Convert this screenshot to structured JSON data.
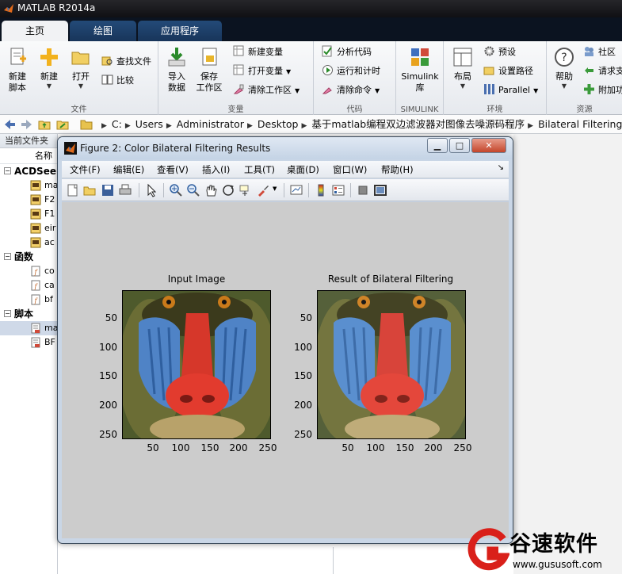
{
  "app": {
    "title": "MATLAB R2014a"
  },
  "ribbon_tabs": [
    {
      "label": "主页",
      "active": true
    },
    {
      "label": "绘图",
      "active": false
    },
    {
      "label": "应用程序",
      "active": false
    }
  ],
  "ribbon": {
    "file": {
      "new_script": "新建\n脚本",
      "new": "新建",
      "open": "打开",
      "find_files": "查找文件",
      "compare": "比较",
      "group": "文件"
    },
    "variable": {
      "import_data": "导入\n数据",
      "save_workspace": "保存\n工作区",
      "new_variable": "新建变量",
      "open_variable": "打开变量",
      "clear_workspace": "清除工作区",
      "group": "变量"
    },
    "code": {
      "analyze": "分析代码",
      "run_time": "运行和计时",
      "clear_commands": "清除命令",
      "group": "代码"
    },
    "simulink": {
      "library": "Simulink\n库",
      "group": "SIMULINK"
    },
    "environment": {
      "layout": "布局",
      "preferences": "预设",
      "set_path": "设置路径",
      "parallel": "Parallel",
      "group": "环境"
    },
    "resources": {
      "help": "帮助",
      "community": "社区",
      "request_support": "请求支",
      "addons": "附加功",
      "group": "资源"
    }
  },
  "address": {
    "path": [
      "C:",
      "Users",
      "Administrator",
      "Desktop",
      "基于matlab编程双边滤波器对图像去噪源码程序",
      "Bilateral Filtering"
    ]
  },
  "left_panel": {
    "header": "当前文件夹",
    "column": "名称",
    "sections": [
      {
        "label": "ACDSee",
        "files": [
          "ma",
          "F2",
          "F1",
          "eir",
          "ac"
        ]
      },
      {
        "label": "函数",
        "files": [
          "co",
          "ca",
          "bf"
        ]
      },
      {
        "label": "脚本",
        "files": [
          "ma",
          "BF"
        ]
      }
    ]
  },
  "figure": {
    "title": "Figure 2: Color Bilateral Filtering Results",
    "menus": [
      "文件(F)",
      "编辑(E)",
      "查看(V)",
      "插入(I)",
      "工具(T)",
      "桌面(D)",
      "窗口(W)",
      "帮助(H)"
    ],
    "axes": [
      {
        "title": "Input Image",
        "yticks": [
          "50",
          "100",
          "150",
          "200",
          "250"
        ],
        "xticks": [
          "50",
          "100",
          "150",
          "200",
          "250"
        ]
      },
      {
        "title": "Result of Bilateral Filtering",
        "yticks": [
          "50",
          "100",
          "150",
          "200",
          "250"
        ],
        "xticks": [
          "50",
          "100",
          "150",
          "200",
          "250"
        ]
      }
    ]
  },
  "watermark": {
    "brand": "谷速软件",
    "url": "www.gususoft.com"
  },
  "colors": {
    "ribbon_active": "#f1f2f4",
    "titlebar": "#101014",
    "figure_bg": "#cccccc",
    "watermark_red": "#d9201a"
  }
}
